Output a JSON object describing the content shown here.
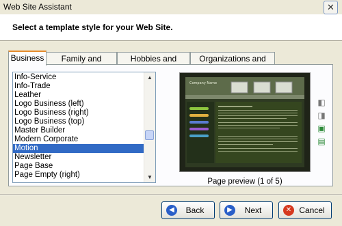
{
  "window": {
    "title": "Web Site Assistant",
    "close_glyph": "✕"
  },
  "header": {
    "heading": "Select a template style for your Web Site."
  },
  "tabs": [
    {
      "label": "Business"
    },
    {
      "label": "Family and Personal"
    },
    {
      "label": "Hobbies and Events"
    },
    {
      "label": "Organizations and Clubs"
    }
  ],
  "templates": [
    "Info-Service",
    "Info-Trade",
    "Leather",
    "Logo Business (left)",
    "Logo Business (right)",
    "Logo Business (top)",
    "Master Builder",
    "Modern Corporate",
    "Motion",
    "Newsletter",
    "Page Base",
    "Page Empty (right)"
  ],
  "selected_template": "Motion",
  "preview": {
    "caption": "Page preview (1 of 5)",
    "brand_text": "Company Name"
  },
  "side_icons": [
    "page-prev-icon",
    "page-next-icon",
    "add-page-icon",
    "export-page-icon"
  ],
  "footer": {
    "back_label": "Back",
    "next_label": "Next",
    "cancel_label": "Cancel"
  },
  "colors": {
    "selection": "#316ac5",
    "tab_accent": "#e68b2c",
    "back_icon": "#2a5fc8",
    "next_icon": "#2a5fc8",
    "cancel_icon": "#d6391f"
  }
}
